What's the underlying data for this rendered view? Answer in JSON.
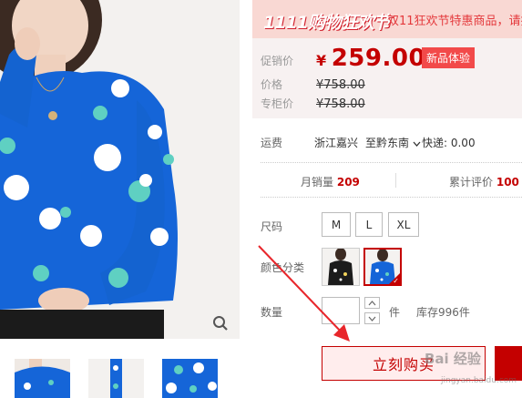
{
  "banner": {
    "logo_text": "1111购物狂欢节",
    "message": "双11狂欢节特惠商品，请提"
  },
  "price": {
    "promo_label": "促销价",
    "currency": "¥",
    "promo_value": "259.00",
    "badge": "新品体验",
    "price_label": "价格",
    "price_value": "¥758.00",
    "counter_label": "专柜价",
    "counter_value": "¥758.00"
  },
  "shipping": {
    "label": "运费",
    "from": "浙江嘉兴",
    "to": "至黔东南",
    "fee": "快递: 0.00"
  },
  "stats": {
    "sales_label": "月销量",
    "sales_value": "209",
    "reviews_label": "累计评价",
    "reviews_value": "100"
  },
  "options": {
    "size_label": "尺码",
    "sizes": [
      "M",
      "L",
      "XL"
    ],
    "color_label": "颜色分类",
    "qty_label": "数量",
    "qty_value": "",
    "qty_unit": "件",
    "stock": "库存996件"
  },
  "buy_button": "立刻购买",
  "watermark": {
    "text": "Bai 经验",
    "url": "jingyan.baidu.com"
  },
  "colors": {
    "accent": "#c40000",
    "sweater": "#1565d8",
    "banner_bg": "#f9d8d3"
  }
}
